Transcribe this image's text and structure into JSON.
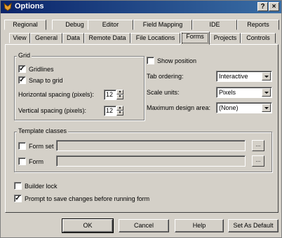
{
  "window": {
    "title": "Options",
    "minimize_label": "?",
    "close_label": "×"
  },
  "tabs_row1": [
    "Regional",
    "Debug",
    "Editor",
    "Field Mapping",
    "IDE",
    "Reports"
  ],
  "tabs_row2": [
    "View",
    "General",
    "Data",
    "Remote Data",
    "File Locations",
    "Forms",
    "Projects",
    "Controls"
  ],
  "selected_tab": "Forms",
  "grid": {
    "legend": "Grid",
    "gridlines_label": "Gridlines",
    "gridlines_checked": true,
    "snap_label": "Snap to grid",
    "snap_checked": true,
    "hspacing_label": "Horizontal spacing (pixels):",
    "hspacing_value": "12",
    "vspacing_label": "Vertical spacing (pixels):",
    "vspacing_value": "12"
  },
  "right": {
    "show_position_label": "Show position",
    "show_position_checked": false,
    "tab_ordering_label": "Tab ordering:",
    "tab_ordering_value": "Interactive",
    "scale_units_label": "Scale units:",
    "scale_units_value": "Pixels",
    "max_design_label": "Maximum design area:",
    "max_design_value": "(None)"
  },
  "template": {
    "legend": "Template classes",
    "formset_label": "Form set",
    "formset_checked": false,
    "form_label": "Form",
    "form_checked": false,
    "browse_label": "..."
  },
  "builder_lock_label": "Builder lock",
  "builder_lock_checked": false,
  "prompt_label": "Prompt to save changes before running form",
  "prompt_checked": true,
  "buttons": {
    "ok": "OK",
    "cancel": "Cancel",
    "help": "Help",
    "set_default": "Set As Default"
  },
  "colors": {
    "titlebar": "#0a246a",
    "face": "#d4d0c8"
  }
}
